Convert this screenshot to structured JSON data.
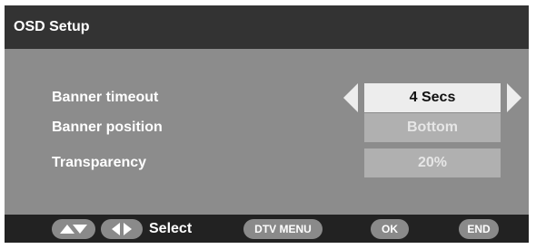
{
  "window": {
    "title": "OSD Setup"
  },
  "settings": [
    {
      "label": "Banner timeout",
      "value": "4 Secs",
      "state": "active"
    },
    {
      "label": "Banner position",
      "value": "Bottom",
      "state": "inactive"
    },
    {
      "label": "Transparency",
      "value": "20%",
      "state": "inactive"
    }
  ],
  "footer": {
    "select_label": "Select",
    "dtv_menu_label": "DTV MENU",
    "ok_label": "OK",
    "end_label": "END"
  },
  "icons": {
    "up_down": "up-down-arrows-icon",
    "left_right": "left-right-arrows-icon",
    "value_prev": "left-arrow-icon",
    "value_next": "right-arrow-icon"
  },
  "colors": {
    "title_bg": "#333333",
    "content_bg": "#8c8c8c",
    "active_value_bg": "#ededed",
    "inactive_value_bg": "#b0b0b0",
    "footer_bg": "#222222",
    "button_bg": "#8a8a8a"
  }
}
